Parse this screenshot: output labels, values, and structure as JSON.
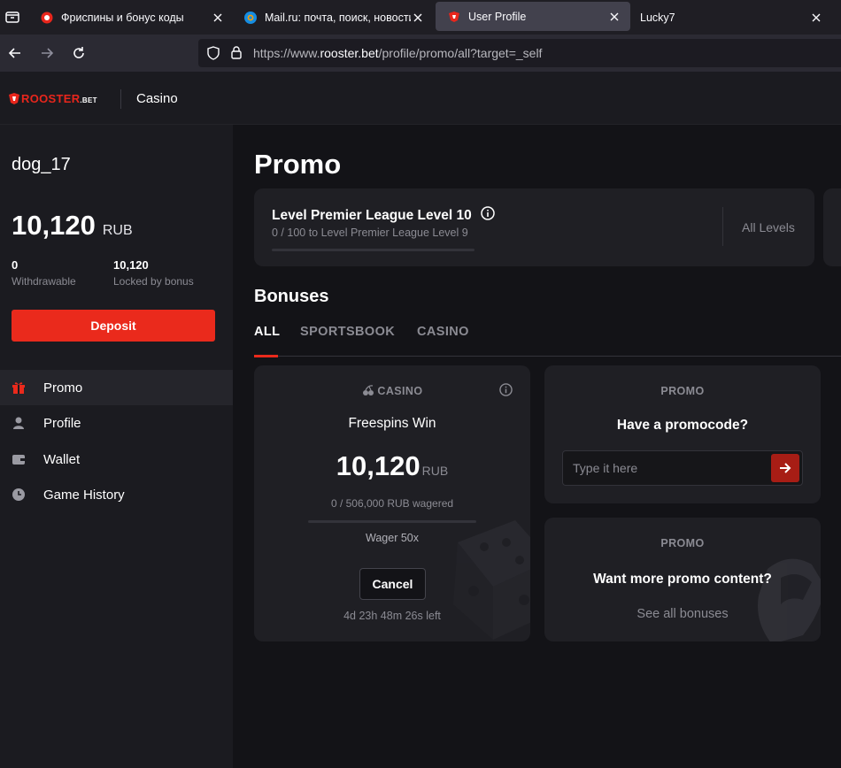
{
  "browser": {
    "tabs": [
      {
        "title": "Фриспины и бонус коды",
        "active": false
      },
      {
        "title": "Mail.ru: почта, поиск, новости, прогноз",
        "active": false
      },
      {
        "title": "User Profile",
        "active": true
      },
      {
        "title": "Lucky7",
        "active": false
      }
    ],
    "url": {
      "prefix": "https://www.",
      "host": "rooster.bet",
      "path": "/profile/promo/all?target=_self"
    }
  },
  "header": {
    "logo": {
      "main": "ROOSTER",
      "suffix": ".BET"
    },
    "section": "Casino"
  },
  "sidebar": {
    "username": "dog_17",
    "balance": {
      "amount": "10,120",
      "currency": "RUB"
    },
    "stats": [
      {
        "value": "0",
        "label": "Withdrawable"
      },
      {
        "value": "10,120",
        "label": "Locked by bonus"
      }
    ],
    "deposit_label": "Deposit",
    "nav": [
      {
        "label": "Promo",
        "icon": "gift-icon",
        "active": true
      },
      {
        "label": "Profile",
        "icon": "user-icon",
        "active": false
      },
      {
        "label": "Wallet",
        "icon": "wallet-icon",
        "active": false
      },
      {
        "label": "Game History",
        "icon": "clock-icon",
        "active": false
      }
    ]
  },
  "main": {
    "title": "Promo",
    "level": {
      "title": "Level Premier League Level 10",
      "subtitle": "0 / 100 to Level Premier League Level 9",
      "progress": 0,
      "all_levels_label": "All Levels"
    },
    "bonuses_title": "Bonuses",
    "tabs": [
      {
        "label": "ALL",
        "active": true
      },
      {
        "label": "SPORTSBOOK",
        "active": false
      },
      {
        "label": "CASINO",
        "active": false
      }
    ],
    "bonus_card": {
      "tag": "CASINO",
      "name": "Freespins Win",
      "amount": "10,120",
      "currency": "RUB",
      "wagered": "0 / 506,000 RUB wagered",
      "progress": 0,
      "wager": "Wager 50x",
      "cancel_label": "Cancel",
      "time_left": "4d 23h 48m 26s left"
    },
    "promocode_card": {
      "tag": "PROMO",
      "title": "Have a promocode?",
      "placeholder": "Type it here"
    },
    "more_card": {
      "tag": "PROMO",
      "title": "Want more promo content?",
      "link": "See all bonuses"
    }
  },
  "colors": {
    "accent": "#ea2a1c",
    "bg": "#131317",
    "panel": "#1b1b20",
    "card": "#1f1f24",
    "muted": "#8b8b93"
  }
}
